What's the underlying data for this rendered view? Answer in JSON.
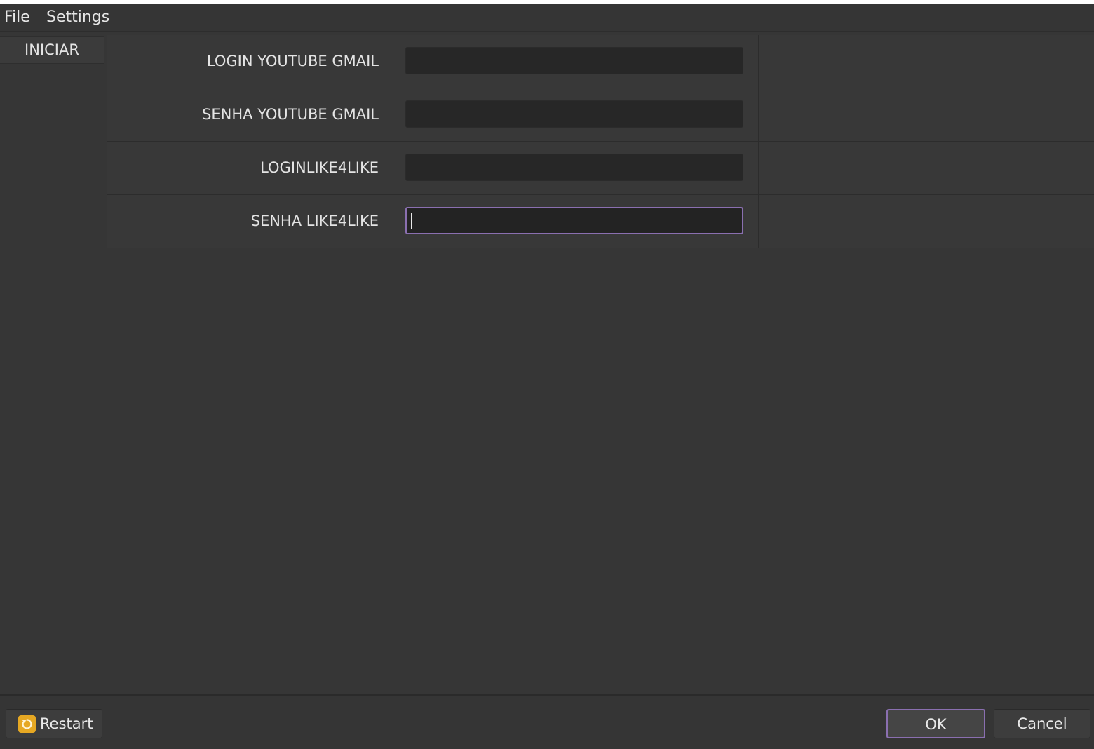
{
  "menubar": {
    "file": "File",
    "settings": "Settings"
  },
  "sidebar": {
    "items": [
      {
        "label": "INICIAR"
      }
    ]
  },
  "form": {
    "fields": [
      {
        "label": "LOGIN YOUTUBE GMAIL",
        "value": "",
        "placeholder": ""
      },
      {
        "label": "SENHA YOUTUBE GMAIL",
        "value": "",
        "placeholder": ""
      },
      {
        "label": "LOGINLIKE4LIKE",
        "value": "",
        "placeholder": ""
      },
      {
        "label": "SENHA LIKE4LIKE",
        "value": "",
        "placeholder": "",
        "focused": true
      }
    ]
  },
  "footer": {
    "restart_label": "Restart",
    "restart_icon": "restart-icon",
    "ok_label": "OK",
    "cancel_label": "Cancel"
  },
  "colors": {
    "background": "#363636",
    "focus_accent": "#8a6fb0",
    "restart_icon": "#e6a823"
  }
}
